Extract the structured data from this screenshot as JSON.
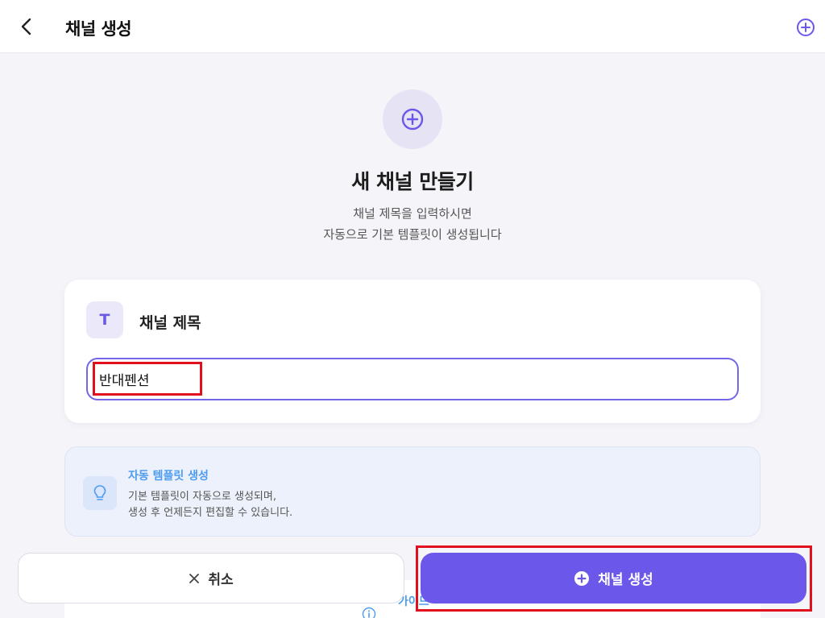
{
  "header": {
    "back_icon": "chevron-left-icon",
    "title": "채널 생성",
    "add_icon": "plus-circle-icon"
  },
  "hero": {
    "icon": "plus-circle-icon",
    "title": "새 채널 만들기",
    "description_line1": "채널 제목을 입력하시면",
    "description_line2": "자동으로 기본 템플릿이 생성됩니다"
  },
  "title_card": {
    "icon_glyph": "T",
    "label": "채널 제목",
    "input_value": "반대펜션",
    "input_placeholder": ""
  },
  "info": {
    "icon": "lightbulb-icon",
    "title": "자동 템플릿 생성",
    "line1": "기본 템플릿이 자동으로 생성되며,",
    "line2": "생성 후 언제든지 편집할 수 있습니다."
  },
  "peek_card": {
    "icon": "info-icon",
    "text": "가이드"
  },
  "actions": {
    "cancel_icon": "close-icon",
    "cancel_label": "취소",
    "create_icon": "plus-circle-icon",
    "create_label": "채널 생성"
  },
  "colors": {
    "accent": "#6b57ea",
    "input_border": "#7366e8",
    "info_blue": "#4c9cf0",
    "background": "#f4f4f9",
    "highlight_red": "#e0101e"
  }
}
